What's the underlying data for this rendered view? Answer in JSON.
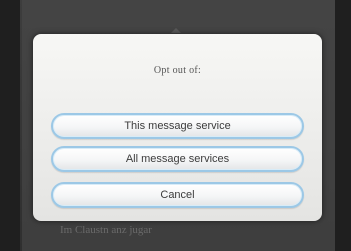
{
  "background": {
    "partial_text": "Im Claustn anz jugar"
  },
  "dialog": {
    "title": "Opt out of:",
    "buttons": {
      "this_service": "This message service",
      "all_services": "All message services",
      "cancel": "Cancel"
    }
  },
  "colors": {
    "button_border": "#9cc8e6",
    "dialog_bg": "#f0f0ee",
    "backdrop": "#3a3a3a"
  }
}
